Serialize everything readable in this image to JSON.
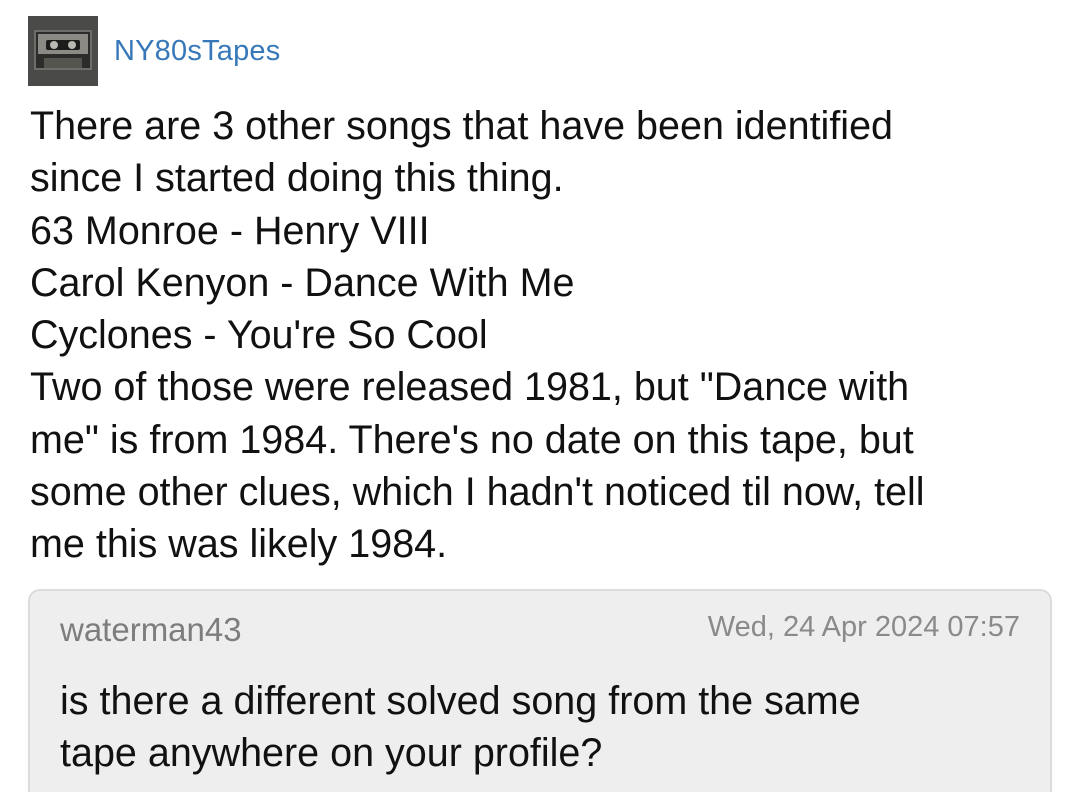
{
  "post": {
    "author": "NY80sTapes",
    "avatar_icon": "cassette-tape-icon",
    "lines": [
      "There are 3 other songs that have been identified",
      "since I started doing this thing.",
      "63 Monroe - Henry VIII",
      "Carol Kenyon - Dance With Me",
      "Cyclones - You're So Cool",
      "Two of those were released 1981, but \"Dance with",
      "me\" is from 1984. There's no date on this tape, but",
      "some other clues, which I hadn't noticed til now, tell",
      "me this was likely 1984."
    ]
  },
  "reply": {
    "author": "waterman43",
    "timestamp": "Wed, 24 Apr 2024 07:57",
    "lines": [
      "is there a different solved song from the same",
      "tape anywhere on your profile?"
    ]
  },
  "colors": {
    "username": "#3778b8",
    "text": "#111111",
    "reply_bg": "#eeeeee",
    "reply_meta": "#7d7d7d"
  }
}
